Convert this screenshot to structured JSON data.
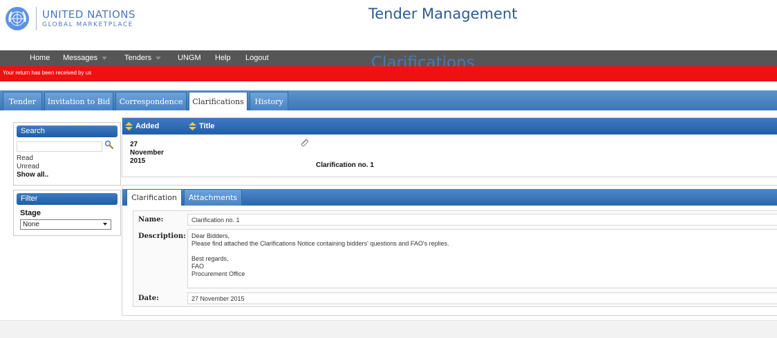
{
  "header": {
    "logo_line1": "UNITED NATIONS",
    "logo_line2": "GLOBAL MARKETPLACE",
    "app_title": "Tender Management"
  },
  "menu": {
    "items": [
      {
        "label": "Home",
        "has_dropdown": false
      },
      {
        "label": "Messages",
        "has_dropdown": true
      },
      {
        "label": "Tenders",
        "has_dropdown": true
      },
      {
        "label": "UNGM",
        "has_dropdown": false
      },
      {
        "label": "Help",
        "has_dropdown": false
      },
      {
        "label": "Logout",
        "has_dropdown": false
      }
    ]
  },
  "page_heading": "Clarifications",
  "alert": {
    "text": "Your return has been received by us",
    "color": "#ee1111"
  },
  "tabs": [
    {
      "label": "Tender",
      "active": false
    },
    {
      "label": "Invitation to Bid",
      "active": false
    },
    {
      "label": "Correspondence",
      "active": false
    },
    {
      "label": "Clarifications",
      "active": true
    },
    {
      "label": "History",
      "active": false
    }
  ],
  "search_panel": {
    "title": "Search",
    "input_value": "",
    "icon": "magnifier-icon",
    "links": [
      "Read",
      "Unread",
      "Show all.."
    ]
  },
  "filter_panel": {
    "title": "Filter",
    "stage_label": "Stage",
    "stage_value": "None"
  },
  "clarification_list": {
    "columns": [
      "Added",
      "Title"
    ],
    "rows": [
      {
        "date_lines": [
          "27",
          "November",
          "2015"
        ],
        "title": "Clarification no. 1",
        "has_attachment": true
      }
    ]
  },
  "detail": {
    "tabs": [
      {
        "label": "Clarification",
        "active": true
      },
      {
        "label": "Attachments",
        "active": false
      }
    ],
    "name_label": "Name:",
    "name_value": "Clarification no. 1",
    "description_label": "Description:",
    "description_lines": [
      "Dear Bidders,",
      "Please find attached the Clarifications Notice containing bidders' questions and FAO's replies.",
      "",
      "Best regards,",
      "FAO",
      "Procurement Office"
    ],
    "date_label": "Date:",
    "date_value": "27 November 2015"
  },
  "colors": {
    "accent_blue": "#2b67ad",
    "menu_bar": "#565656",
    "alert_red": "#ee1111"
  }
}
